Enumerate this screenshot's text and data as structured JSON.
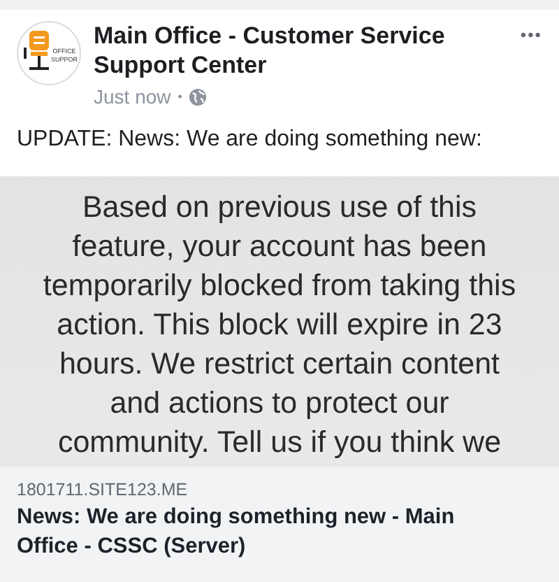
{
  "post": {
    "author": "Main Office - Customer Service Support Center",
    "avatar_text": [
      "OFFICE",
      "SUPPOR"
    ],
    "time": "Just now",
    "separator": "•",
    "menu": "•••",
    "message": "UPDATE: News: We are doing something new:"
  },
  "link_preview": {
    "image_lines": [
      "Based on previous use of this",
      "feature, your account has been",
      "temporarily blocked from taking this",
      "action. This block will expire in 23",
      "hours. We restrict certain content",
      "and actions to protect our",
      "community. Tell us if you think we"
    ],
    "domain": "1801711.SITE123.ME",
    "title": "News: We are doing something new - Main Office - CSSC (Server)"
  }
}
